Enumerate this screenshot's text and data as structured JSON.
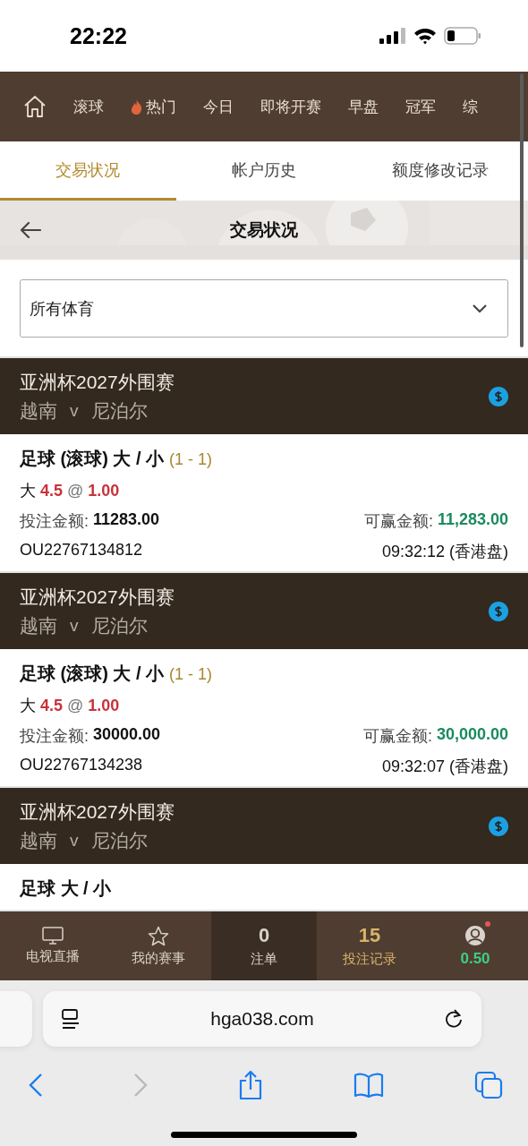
{
  "status_bar": {
    "time": "22:22"
  },
  "top_nav": {
    "items": [
      {
        "kind": "home"
      },
      {
        "kind": "text",
        "label": "滚球"
      },
      {
        "kind": "hot",
        "label": "热门"
      },
      {
        "kind": "text",
        "label": "今日"
      },
      {
        "kind": "text",
        "label": "即将开赛"
      },
      {
        "kind": "text",
        "label": "早盘"
      },
      {
        "kind": "text",
        "label": "冠军"
      },
      {
        "kind": "text",
        "label": "综"
      }
    ]
  },
  "tabs": [
    {
      "label": "交易状况",
      "selected": true
    },
    {
      "label": "帐户历史",
      "selected": false
    },
    {
      "label": "额度修改记录",
      "selected": false
    }
  ],
  "page_header": {
    "title": "交易状况"
  },
  "sport_filter": {
    "value": "所有体育"
  },
  "bets": [
    {
      "league": "亚洲杯2027外围赛",
      "home": "越南",
      "vs": "v",
      "away": "尼泊尔",
      "market": "足球 (滚球) 大 / 小",
      "score": "(1 - 1)",
      "pick": "大",
      "line": "4.5",
      "at": "@",
      "odds": "1.00",
      "stake_label": "投注金额:",
      "stake": "11283.00",
      "win_label": "可赢金额:",
      "win": "11,283.00",
      "ticket": "OU22767134812",
      "time": "09:32:12 (香港盘)"
    },
    {
      "league": "亚洲杯2027外围赛",
      "home": "越南",
      "vs": "v",
      "away": "尼泊尔",
      "market": "足球 (滚球) 大 / 小",
      "score": "(1 - 1)",
      "pick": "大",
      "line": "4.5",
      "at": "@",
      "odds": "1.00",
      "stake_label": "投注金额:",
      "stake": "30000.00",
      "win_label": "可赢金额:",
      "win": "30,000.00",
      "ticket": "OU22767134238",
      "time": "09:32:07 (香港盘)"
    },
    {
      "league": "亚洲杯2027外围赛",
      "home": "越南",
      "vs": "v",
      "away": "尼泊尔",
      "market": "足球 大 / 小"
    }
  ],
  "bottom_nav": {
    "items": [
      {
        "kind": "tv",
        "label": "电视直播",
        "selected": false
      },
      {
        "kind": "star",
        "label": "我的赛事",
        "selected": false
      },
      {
        "kind": "slip",
        "count": "0",
        "label": "注单",
        "selected": false
      },
      {
        "kind": "count",
        "count": "15",
        "label": "投注记录",
        "selected": true
      },
      {
        "kind": "account",
        "balance": "0.50",
        "alert": true,
        "selected": false
      }
    ]
  },
  "browser": {
    "url": "hga038.com"
  }
}
